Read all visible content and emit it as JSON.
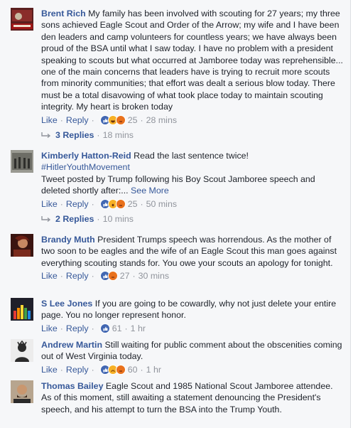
{
  "common": {
    "like": "Like",
    "reply": "Reply",
    "see_more": "See More"
  },
  "comments": [
    {
      "name": "Brent Rich",
      "text": "My family has been involved with scouting for 27 years; my three sons achieved Eagle Scout and Order of the Arrow; my wife and I have been den leaders and camp volunteers for countless years; we have always been proud of the BSA until what I saw today. I have no problem with a president speaking to scouts but what occurred at Jamboree today was reprehensible... one of the main concerns that leaders have is trying to recruit more scouts from minority communities; that effort was dealt a serious blow today. There must be a total disavowing of what took place today to maintain scouting integrity. My heart is broken today",
      "reactions": [
        "like",
        "haha",
        "angry"
      ],
      "count": "25",
      "time": "28 mins",
      "replies": "3 Replies",
      "replies_time": "18 mins"
    },
    {
      "name": "Kimberly Hatton-Reid",
      "text_a": "Read the last sentence twice!",
      "hashtag": "#HitlerYouthMovement",
      "text_b": "Tweet posted by Trump following his Boy Scout Jamboree speech and deleted shortly after:...",
      "reactions": [
        "like",
        "wow",
        "angry"
      ],
      "count": "25",
      "time": "50 mins",
      "replies": "2 Replies",
      "replies_time": "10 mins"
    },
    {
      "name": "Brandy Muth",
      "text": "President Trumps speech was horrendous. As the mother of two soon to be eagles and the wife of an Eagle Scout this man goes against everything scouting stands for. You owe your scouts an apology for tonight.",
      "reactions": [
        "like",
        "angry"
      ],
      "count": "27",
      "time": "30 mins"
    },
    {
      "name": "S Lee Jones",
      "text": "If you are going to be cowardly, why not just delete your entire page. You no longer represent honor.",
      "reactions": [
        "like"
      ],
      "count": "61",
      "time": "1 hr"
    },
    {
      "name": "Andrew Martin",
      "text": "Still waiting for public comment about the obscenities coming out of West Virginia today.",
      "reactions": [
        "like",
        "sad",
        "angry"
      ],
      "count": "60",
      "time": "1 hr"
    },
    {
      "name": "Thomas Bailey",
      "text": "Eagle Scout and 1985 National Scout Jamboree attendee. As of this moment, still awaiting a statement denouncing the President's speech, and his attempt to turn the BSA into the Trump Youth."
    }
  ],
  "colors": {
    "link": "#365899",
    "meta": "#90949c",
    "background": "#f6f7f9",
    "like": "#4267b2",
    "angry": "#e9711c",
    "yellow": "#f7b125"
  }
}
